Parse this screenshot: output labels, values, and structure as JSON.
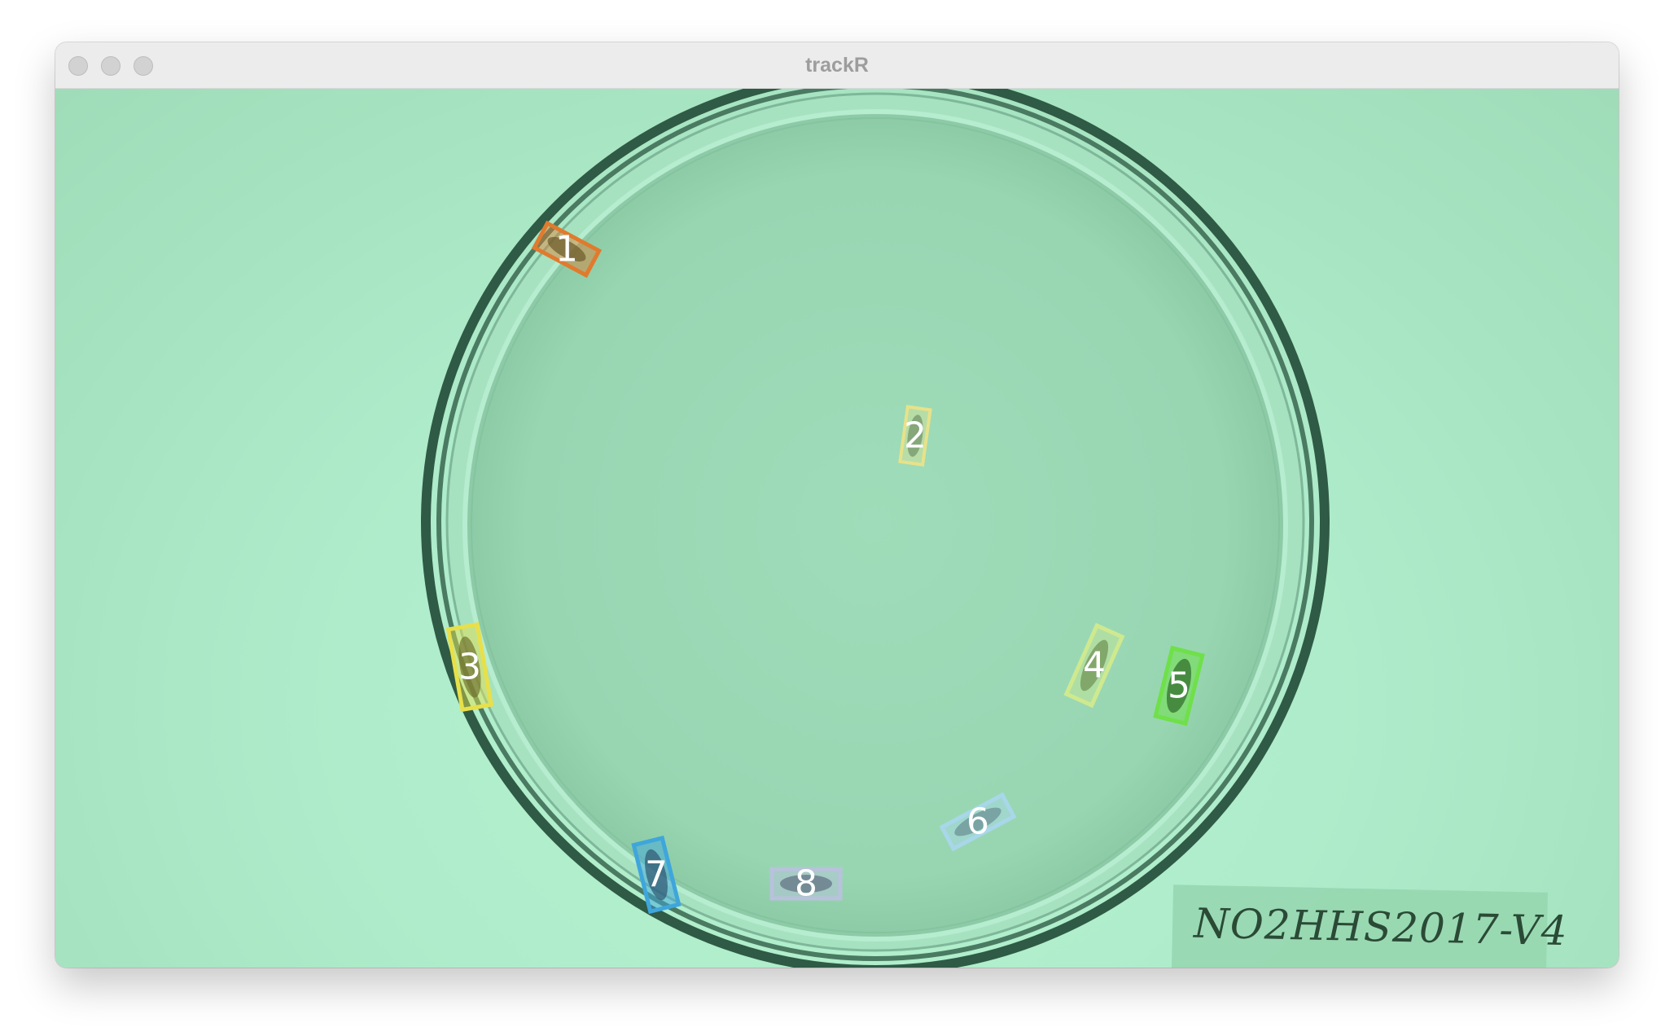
{
  "window": {
    "title": "trackR"
  },
  "tracks": [
    {
      "id": "1",
      "color": "#e07b2e"
    },
    {
      "id": "2",
      "color": "#e7e28a"
    },
    {
      "id": "3",
      "color": "#e8e04a"
    },
    {
      "id": "4",
      "color": "#cfe98f"
    },
    {
      "id": "5",
      "color": "#6fe04a"
    },
    {
      "id": "6",
      "color": "#a8d7ea"
    },
    {
      "id": "7",
      "color": "#3fa6dc"
    },
    {
      "id": "8",
      "color": "#b8c2dc"
    }
  ],
  "sample_label": "NO2HHS2017-V4"
}
